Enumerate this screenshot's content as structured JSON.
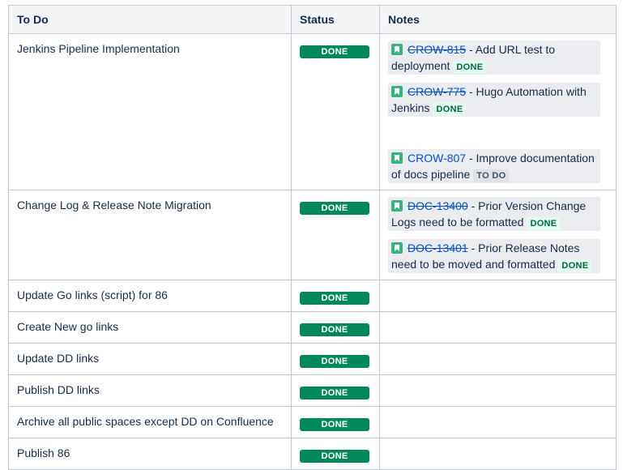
{
  "headers": {
    "todo": "To Do",
    "status": "Status",
    "notes": "Notes"
  },
  "rows": [
    {
      "task": "Jenkins Pipeline Implementation",
      "status": "DONE",
      "notes": [
        {
          "key": "CROW-815",
          "summary": " - Add URL test to deployment",
          "status": "DONE",
          "resolved": true
        },
        {
          "key": "CROW-775",
          "summary": " - Hugo Automation with Jenkins",
          "status": "DONE",
          "resolved": true
        },
        {
          "key": "CROW-807",
          "summary": " - Improve documentation of docs pipeline",
          "status": "TO DO",
          "resolved": false
        }
      ]
    },
    {
      "task": "Change Log & Release Note Migration",
      "status": "DONE",
      "notes": [
        {
          "key": "DOC-13400",
          "summary": " - Prior Version Change Logs need to be formatted",
          "status": "DONE",
          "resolved": true
        },
        {
          "key": "DOC-13401",
          "summary": " - Prior Release Notes need to be moved and formatted",
          "status": "DONE",
          "resolved": true
        }
      ]
    },
    {
      "task": "Update Go links (script) for 86",
      "status": "DONE",
      "notes": []
    },
    {
      "task": "Create New go links",
      "status": "DONE",
      "notes": []
    },
    {
      "task": "Update DD links",
      "status": "DONE",
      "notes": []
    },
    {
      "task": "Publish DD links",
      "status": "DONE",
      "notes": []
    },
    {
      "task": "Archive all public spaces except DD on Confluence",
      "status": "DONE",
      "notes": []
    },
    {
      "task": "Publish 86",
      "status": "DONE",
      "notes": []
    }
  ]
}
